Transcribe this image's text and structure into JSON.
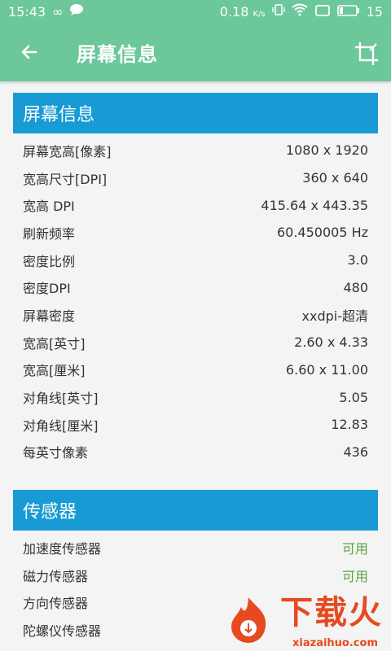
{
  "status_bar": {
    "time": "15:43",
    "speed": "0.18",
    "speed_unit": "K/s",
    "battery": "15",
    "icons": [
      "infinity-icon",
      "chat-icon",
      "vibrate-icon",
      "wifi-icon",
      "screen-icon",
      "battery-icon"
    ]
  },
  "app_bar": {
    "title": "屏幕信息",
    "back_icon": "arrow-left-icon",
    "crop_icon": "crop-icon"
  },
  "screen_section": {
    "header": "屏幕信息",
    "rows": [
      {
        "label": "屏幕宽高[像素]",
        "value": "1080 x 1920"
      },
      {
        "label": "宽高尺寸[DPI]",
        "value": "360 x 640"
      },
      {
        "label": "宽高 DPI",
        "value": "415.64 x 443.35"
      },
      {
        "label": "刷新频率",
        "value": "60.450005 Hz"
      },
      {
        "label": "密度比例",
        "value": "3.0"
      },
      {
        "label": "密度DPI",
        "value": "480"
      },
      {
        "label": "屏幕密度",
        "value": "xxdpi-超清"
      },
      {
        "label": "宽高[英寸]",
        "value": "2.60 x 4.33"
      },
      {
        "label": "宽高[厘米]",
        "value": "6.60 x 11.00"
      },
      {
        "label": "对角线[英寸]",
        "value": "5.05"
      },
      {
        "label": "对角线[厘米]",
        "value": "12.83"
      },
      {
        "label": "每英寸像素",
        "value": "436"
      }
    ]
  },
  "sensor_section": {
    "header": "传感器",
    "rows": [
      {
        "label": "加速度传感器",
        "value": "可用"
      },
      {
        "label": "磁力传感器",
        "value": "可用"
      },
      {
        "label": "方向传感器",
        "value": ""
      },
      {
        "label": "陀螺仪传感器",
        "value": ""
      }
    ]
  },
  "watermark": {
    "text": "下载火",
    "url": "xiazaihuo.com"
  },
  "colors": {
    "app_bar": "#6cc79b",
    "section_header": "#189bd4",
    "available": "#5ca13b",
    "watermark": "#e64a20"
  }
}
